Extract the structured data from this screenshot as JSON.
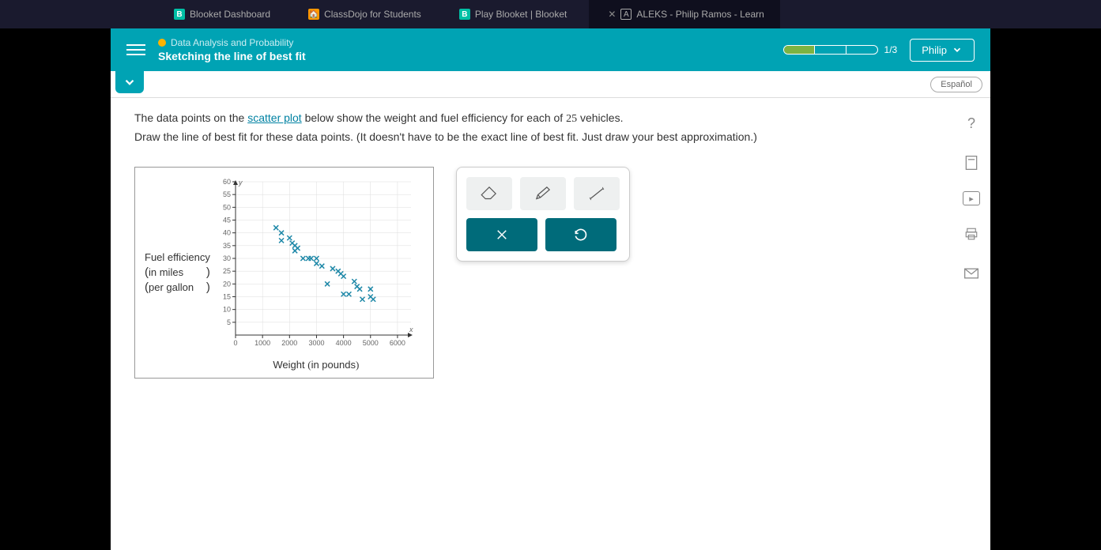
{
  "browser": {
    "tabs": [
      {
        "label": "Blooket Dashboard",
        "icon": "B"
      },
      {
        "label": "ClassDojo for Students",
        "icon": "C"
      },
      {
        "label": "Play Blooket | Blooket",
        "icon": "B"
      },
      {
        "label": "ALEKS - Philip Ramos - Learn",
        "icon": "A"
      }
    ]
  },
  "header": {
    "category": "Data Analysis and Probability",
    "title": "Sketching the line of best fit",
    "progress_text": "1/3",
    "user": "Philip"
  },
  "subbar": {
    "language": "Español"
  },
  "question": {
    "line1_a": "The data points on the ",
    "link": "scatter plot",
    "line1_b": " below show the weight and fuel efficiency for each of ",
    "count": "25",
    "line1_c": " vehicles.",
    "line2": "Draw the line of best fit for these data points. (It doesn't have to be the exact line of best fit. Just draw your best approximation.)"
  },
  "chart_data": {
    "type": "scatter",
    "xlabel": "Weight (in pounds)",
    "ylabel_top": "Fuel efficiency",
    "ylabel_mid": "in miles",
    "ylabel_bot": "per gallon",
    "xrange": [
      0,
      6500
    ],
    "yrange": [
      0,
      60
    ],
    "xticks": [
      0,
      1000,
      2000,
      3000,
      4000,
      5000,
      6000
    ],
    "yticks": [
      5,
      10,
      15,
      20,
      25,
      30,
      35,
      40,
      45,
      50,
      55,
      60
    ],
    "points": [
      [
        1500,
        42
      ],
      [
        1700,
        40
      ],
      [
        1700,
        37
      ],
      [
        2000,
        38
      ],
      [
        2100,
        36
      ],
      [
        2200,
        35
      ],
      [
        2200,
        33
      ],
      [
        2300,
        34
      ],
      [
        2500,
        30
      ],
      [
        2700,
        30
      ],
      [
        2800,
        30
      ],
      [
        3000,
        28
      ],
      [
        3000,
        30
      ],
      [
        3200,
        27
      ],
      [
        3400,
        20
      ],
      [
        3600,
        26
      ],
      [
        3800,
        25
      ],
      [
        3900,
        24
      ],
      [
        4000,
        23
      ],
      [
        4000,
        16
      ],
      [
        4200,
        16
      ],
      [
        4400,
        21
      ],
      [
        4500,
        19
      ],
      [
        4600,
        18
      ],
      [
        4700,
        14
      ],
      [
        5000,
        18
      ],
      [
        5000,
        15
      ],
      [
        5100,
        14
      ]
    ]
  },
  "tools": {
    "eraser": "eraser",
    "pencil": "pencil",
    "line": "line",
    "clear": "X",
    "undo": "↺"
  },
  "side": {
    "help": "?",
    "calc": "calc",
    "video": "▸",
    "print": "print",
    "mail": "mail"
  }
}
